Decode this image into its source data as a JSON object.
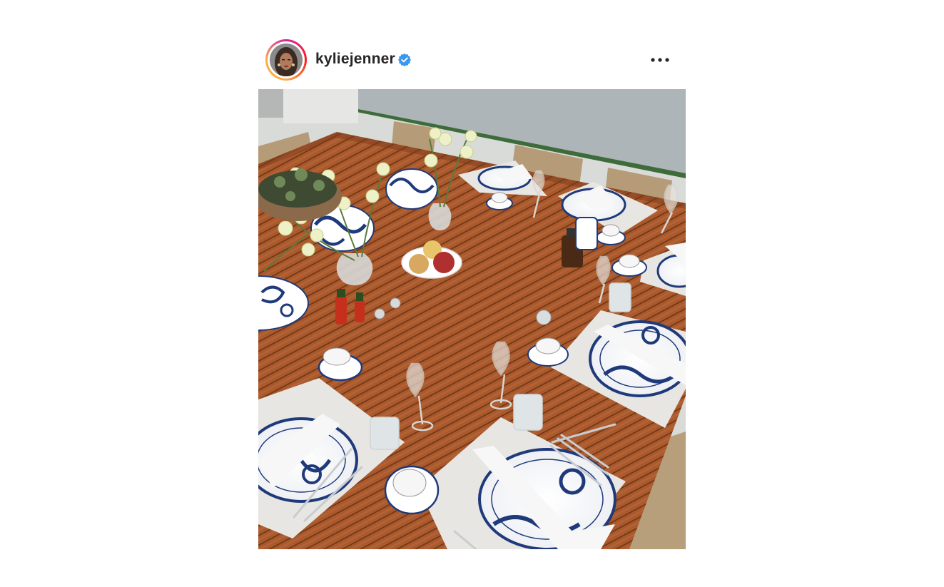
{
  "post": {
    "username": "kyliejenner",
    "verified_icon": "verified-badge-icon",
    "more_icon": "more-options-icon"
  },
  "colors": {
    "verified": "#3897f0",
    "text": "#262626",
    "table_wood": "#a8582a",
    "plate_blue": "#1f3a7a"
  }
}
